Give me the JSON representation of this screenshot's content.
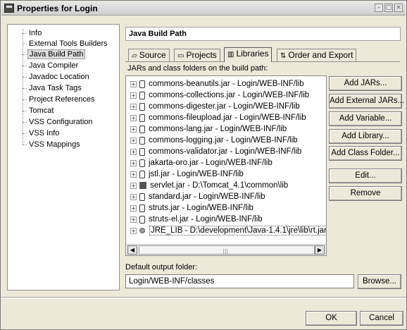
{
  "window": {
    "title": "Properties for Login",
    "controls": {
      "minimize": "–",
      "maximize": "□",
      "close": "×"
    }
  },
  "nav": {
    "items": [
      {
        "label": "Info",
        "selected": false
      },
      {
        "label": "External Tools Builders",
        "selected": false
      },
      {
        "label": "Java Build Path",
        "selected": true
      },
      {
        "label": "Java Compiler",
        "selected": false
      },
      {
        "label": "Javadoc Location",
        "selected": false
      },
      {
        "label": "Java Task Tags",
        "selected": false
      },
      {
        "label": "Project References",
        "selected": false
      },
      {
        "label": "Tomcat",
        "selected": false
      },
      {
        "label": "VSS Configuration",
        "selected": false
      },
      {
        "label": "VSS Info",
        "selected": false
      },
      {
        "label": "VSS Mappings",
        "selected": false
      }
    ]
  },
  "page": {
    "title": "Java Build Path",
    "tabs": [
      {
        "label": "Source",
        "icon": "source-folder-icon",
        "active": false
      },
      {
        "label": "Projects",
        "icon": "projects-icon",
        "active": false
      },
      {
        "label": "Libraries",
        "icon": "libraries-icon",
        "active": true
      },
      {
        "label": "Order and Export",
        "icon": "order-icon",
        "active": false
      }
    ],
    "section_label": "JARs and class folders on the build path:",
    "libraries": [
      {
        "label": "commons-beanutils.jar - Login/WEB-INF/lib",
        "kind": "jar"
      },
      {
        "label": "commons-collections.jar - Login/WEB-INF/lib",
        "kind": "jar"
      },
      {
        "label": "commons-digester.jar - Login/WEB-INF/lib",
        "kind": "jar"
      },
      {
        "label": "commons-fileupload.jar - Login/WEB-INF/lib",
        "kind": "jar"
      },
      {
        "label": "commons-lang.jar - Login/WEB-INF/lib",
        "kind": "jar"
      },
      {
        "label": "commons-logging.jar - Login/WEB-INF/lib",
        "kind": "jar"
      },
      {
        "label": "commons-validator.jar - Login/WEB-INF/lib",
        "kind": "jar"
      },
      {
        "label": "jakarta-oro.jar - Login/WEB-INF/lib",
        "kind": "jar"
      },
      {
        "label": "jstl.jar - Login/WEB-INF/lib",
        "kind": "jar"
      },
      {
        "label": "servlet.jar - D:\\Tomcat_4.1\\common\\lib",
        "kind": "external-jar"
      },
      {
        "label": "standard.jar - Login/WEB-INF/lib",
        "kind": "jar"
      },
      {
        "label": "struts.jar - Login/WEB-INF/lib",
        "kind": "jar"
      },
      {
        "label": "struts-el.jar - Login/WEB-INF/lib",
        "kind": "jar"
      },
      {
        "label": "JRE_LIB - D:\\development\\Java-1.4.1\\jre\\lib\\rt.jar",
        "kind": "variable",
        "selected": true
      }
    ],
    "buttons": {
      "add_jars": "Add JARs...",
      "add_external_jars": "Add External JARs...",
      "add_variable": "Add Variable...",
      "add_library": "Add Library...",
      "add_class_folder": "Add Class Folder...",
      "edit": "Edit...",
      "remove": "Remove"
    },
    "output_label": "Default output folder:",
    "output_value": "Login/WEB-INF/classes",
    "browse": "Browse..."
  },
  "footer": {
    "ok": "OK",
    "cancel": "Cancel"
  }
}
